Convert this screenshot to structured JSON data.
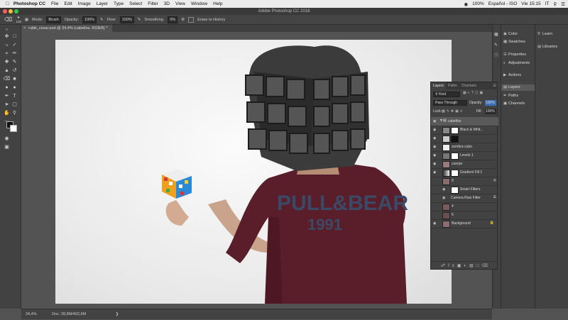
{
  "menubar": {
    "app": "Photoshop CC",
    "items": [
      "File",
      "Edit",
      "Image",
      "Layer",
      "Type",
      "Select",
      "Filter",
      "3D",
      "View",
      "Window",
      "Help"
    ],
    "battery": "100%",
    "language": "Español - ISO",
    "datetime": "Vie 15:15",
    "locale": "IT"
  },
  "window": {
    "title": "Adobe Photoshop CC 2018"
  },
  "options": {
    "brush_size": "126",
    "mode_label": "Mode:",
    "mode_value": "Brush",
    "opacity_label": "Opacity:",
    "opacity_value": "100%",
    "flow_label": "Flow:",
    "flow_value": "100%",
    "smoothing_label": "Smoothing:",
    "smoothing_value": "0%",
    "erase_history": "Erase to History"
  },
  "document": {
    "tab": "rubik_cesar.psd @ 34,4% (cabellos, RGB/8) *"
  },
  "status": {
    "zoom": "34,4%",
    "doc": "Doc: 28,8M/402,6M"
  },
  "dock1": [
    {
      "icon": "palette-icon",
      "label": "Color"
    },
    {
      "icon": "grid-icon",
      "label": "Swatches"
    },
    {
      "icon": "sliders-icon",
      "label": "Properties"
    },
    {
      "icon": "circle-half-icon",
      "label": "Adjustments"
    },
    {
      "icon": "play-icon",
      "label": "Actions"
    },
    {
      "icon": "layers-icon",
      "label": "Layers"
    },
    {
      "icon": "pen-icon",
      "label": "Paths"
    },
    {
      "icon": "channels-icon",
      "label": "Channels"
    }
  ],
  "dock2": [
    {
      "icon": "bulb-icon",
      "label": "Learn"
    },
    {
      "icon": "library-icon",
      "label": "Libraries"
    }
  ],
  "layers_panel": {
    "tabs": [
      "Layers",
      "Paths",
      "Channels"
    ],
    "filter": "Kind",
    "blend": "Pass Through",
    "opacity_label": "Opacity:",
    "opacity_value": "100%",
    "lock_label": "Lock:",
    "fill_label": "Fill:",
    "fill_value": "100%",
    "layers": [
      {
        "name": "cabellos",
        "type": "group",
        "selected": true
      },
      {
        "name": "Black & Whit...",
        "type": "adjustment"
      },
      {
        "name": "",
        "type": "masked"
      },
      {
        "name": "sombra cubo",
        "type": "pixel"
      },
      {
        "name": "Levels 1",
        "type": "adjustment"
      },
      {
        "name": "cuerpo",
        "type": "pixel"
      },
      {
        "name": "Gradient Fill 1",
        "type": "adjustment"
      },
      {
        "name": "8",
        "type": "smart"
      },
      {
        "name": "Smart Filters",
        "type": "filters"
      },
      {
        "name": "Camera Raw Filter",
        "type": "filter"
      },
      {
        "name": "4",
        "type": "pixel"
      },
      {
        "name": "6",
        "type": "pixel"
      },
      {
        "name": "Background",
        "type": "background"
      }
    ]
  },
  "artwork": {
    "shirt_text_line1": "PULL&BEAR",
    "shirt_text_line2": "1991"
  },
  "colors": {
    "canvas_bg": "#e8e8e8",
    "ui_dark": "#424242",
    "shirt": "#5a1e2b"
  }
}
